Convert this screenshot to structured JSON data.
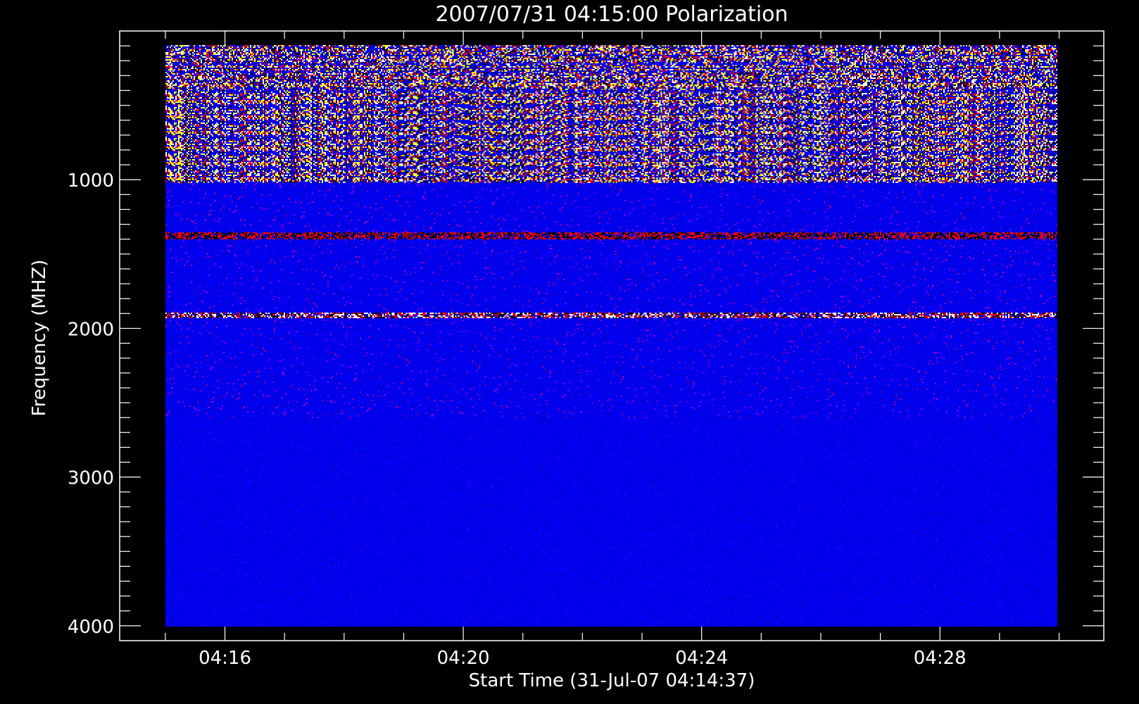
{
  "chart_data": {
    "type": "heatmap",
    "title": "2007/07/31 04:15:00 Polarization",
    "xlabel": "Start Time (31-Jul-07 04:14:37)",
    "ylabel": "Frequency (MHZ)",
    "x_start": "04:15:00",
    "x_end": "04:30:00",
    "xlim": [
      "04:14:14",
      "04:30:45"
    ],
    "x_ticks": [
      "04:16",
      "04:20",
      "04:24",
      "04:28"
    ],
    "y_ticks": [
      1000,
      2000,
      3000,
      4000
    ],
    "ylim": [
      4100,
      0
    ],
    "y_range_data": [
      100,
      4000
    ],
    "y_axis_reversed": true,
    "colorscale": [
      "#000000",
      "#0000ff",
      "#ff0000",
      "#ffff00",
      "#ffffff"
    ],
    "background": "#0000ff",
    "features": [
      {
        "freq_range": [
          100,
          1020
        ],
        "level": "noisy",
        "colors": [
          "#ff0000",
          "#ffff00",
          "#ffffff",
          "#000000"
        ]
      },
      {
        "freq_range": [
          1350,
          1400
        ],
        "level": "strong-red",
        "colors": [
          "#ff0000",
          "#000000"
        ]
      },
      {
        "freq_range": [
          1890,
          1935
        ],
        "level": "strong-red",
        "colors": [
          "#ff0000",
          "#ffffff",
          "#000000"
        ]
      }
    ]
  }
}
